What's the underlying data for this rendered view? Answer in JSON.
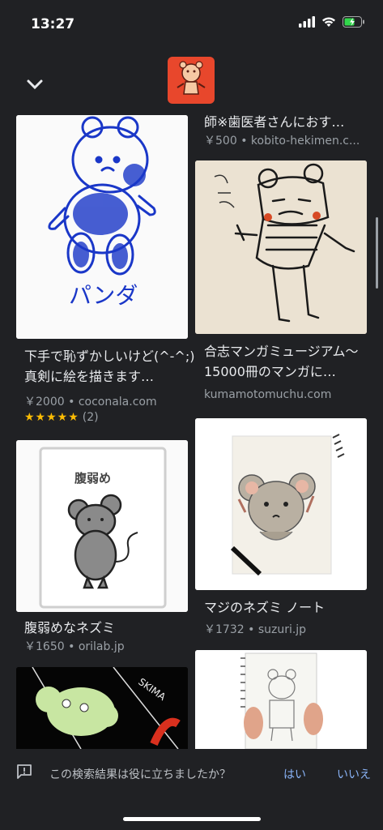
{
  "status_bar": {
    "time": "13:27"
  },
  "header": {
    "collapse_icon": "chevron-down-icon"
  },
  "left_column": [
    {
      "title": "下手で恥ずかしいけど(^-^;)真剣に絵を描きます…",
      "price": "￥2000",
      "source": "coconala.com",
      "rating": "★★★★★",
      "rating_count": "(2)",
      "image_text": "パンダ"
    },
    {
      "title": "腹弱めなネズミ",
      "price": "￥1650",
      "source": "orilab.jp",
      "image_text": "腹弱め"
    },
    {
      "image_text": "SKIMA"
    }
  ],
  "right_column": [
    {
      "title": "師※歯医者さんにおす…",
      "price": "￥500",
      "source": "kobito-hekimen.c..."
    },
    {
      "title": "合志マンガミュージアム〜15000冊のマンガに…",
      "source": "kumamotomuchu.com"
    },
    {
      "title": "マジのネズミ ノート",
      "price": "￥1732",
      "source": "suzuri.jp"
    },
    {}
  ],
  "feedback": {
    "question": "この検索結果は役に立ちましたか？",
    "yes": "はい",
    "no": "いいえ"
  },
  "colors": {
    "background": "#202124",
    "link": "#8ab4f8",
    "star": "#fbbc04"
  }
}
